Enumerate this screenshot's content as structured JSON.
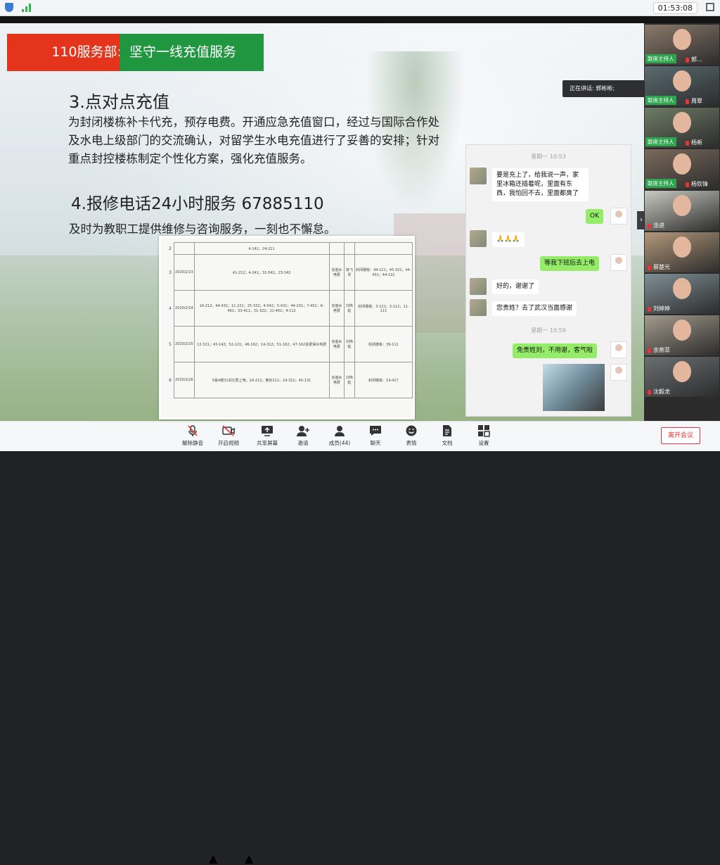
{
  "topbar": {
    "timer": "01:53:08"
  },
  "slide": {
    "title_left": "110服务部:",
    "title_right": "坚守一线充值服务",
    "heading3": "3.点对点充值",
    "para3": "为封闭楼栋补卡代充，预存电费。开通应急充值窗口，经过与国际合作处及水电上级部门的交流确认，对留学生水电充值进行了妥善的安排；针对重点封控楼栋制定个性化方案，强化充值服务。",
    "heading4": "4.报修电话24小时服务 67885110",
    "para4": "及时为教职工提供维修与咨询服务，一刻也不懈怠。",
    "photo_rows": [
      {
        "num": "2",
        "date": "",
        "rooms": "4-141；24-211",
        "type": "",
        "person": "",
        "note": ""
      },
      {
        "num": "3",
        "date": "2020/2/23",
        "rooms": "41-212；4-241；31-542；23-342",
        "type": "充值水电费",
        "person": "徐飞琴",
        "note": "封闭楼栋：44-121；45-321；44-431；44-131"
      },
      {
        "num": "4",
        "date": "2020/2/24",
        "rooms": "14-212；44-432；11-221；25-332；4-542；5-421；44-231；7-451；6-461；33-411；31-322；11-462；4-112",
        "type": "充值水电费",
        "person": "刘伟延",
        "note": "封闭楼栋：3-121；3-112；11-111"
      },
      {
        "num": "5",
        "date": "2020/2/25",
        "rooms": "12-321；43-142；52-121；46-162；14-312；51-162；47-162资费保水电费",
        "type": "充值水电费",
        "person": "刘伟延",
        "note": "封闭楼栋：39-111"
      },
      {
        "num": "6",
        "date": "2020/2/26",
        "rooms": "5栋4楼31间欠费上电；24-212；黄好211；24-321；40-131",
        "type": "充值水电费",
        "person": "刘伟延",
        "note": "封闭楼栋：14-417"
      }
    ]
  },
  "speaking": "正在讲话: 郭彬彬;",
  "chat": {
    "ts1": "星期一 10:53",
    "ts2": "星期一 10:59",
    "m1": "要是充上了，给我说一声，家里冰箱还插着呢，里面有东西，我怕回不去，里面都臭了",
    "m2": "OK",
    "m3": "🙏🙏🙏",
    "m4": "等我下班后去上电",
    "m5": "好的，谢谢了",
    "m6": "您贵姓？去了武汉当面感谢",
    "m7": "免贵姓刘，不用谢，客气啦"
  },
  "participants": [
    {
      "name": "郭…",
      "host": "联席主持人"
    },
    {
      "name": "周翠",
      "host": "联席主持人"
    },
    {
      "name": "杨新",
      "host": "联席主持人"
    },
    {
      "name": "杨钦锋",
      "host": "联席主持人"
    },
    {
      "name": "涂进",
      "host": ""
    },
    {
      "name": "蔡楚元",
      "host": ""
    },
    {
      "name": "刘婷婷",
      "host": ""
    },
    {
      "name": "余燕菲",
      "host": ""
    },
    {
      "name": "沈毅龙",
      "host": ""
    }
  ],
  "toolbar": {
    "mute": "解除静音",
    "video": "开启视频",
    "share": "共享屏幕",
    "invite": "邀请",
    "members": "成员(44)",
    "chat": "聊天",
    "reactions": "表情",
    "docs": "文档",
    "settings": "设置",
    "leave": "离开会议"
  }
}
